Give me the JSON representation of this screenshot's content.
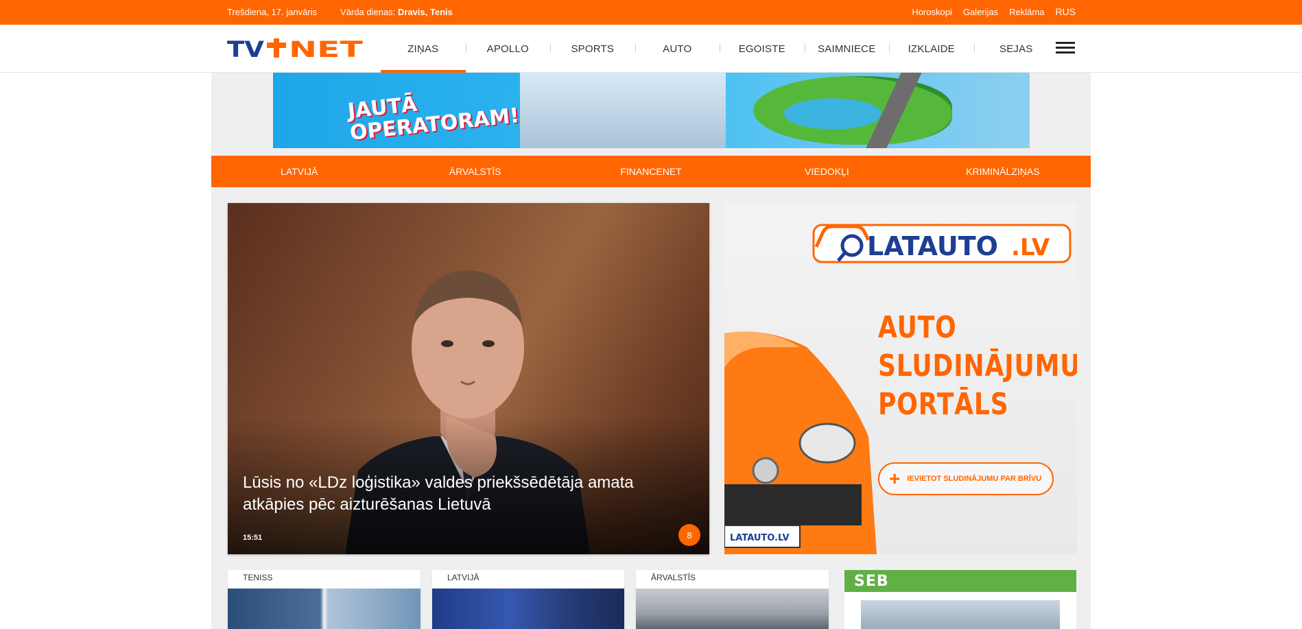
{
  "topbar": {
    "date": "Trešdiena, 17. janvāris",
    "nameday_label": "Vārda dienas:",
    "nameday_names": "Dravis, Tenis",
    "links": [
      "Horoskopi",
      "Galerijas",
      "Reklāma"
    ],
    "lang": "RUS"
  },
  "header": {
    "logo_text": "TV+NET",
    "nav": [
      "ZIŅAS",
      "APOLLO",
      "SPORTS",
      "AUTO",
      "EGOISTE",
      "SAIMNIECE",
      "IZKLAIDE",
      "SEJAS"
    ],
    "active_nav": "ZIŅAS"
  },
  "banner": {
    "line1": "JAUTĀ",
    "line2": "OPERATORAM!"
  },
  "subnav": [
    "LATVIJĀ",
    "ĀRVALSTĪS",
    "FINANCENET",
    "VIEDOKĻI",
    "KRIMINĀLZIŅAS"
  ],
  "hero": {
    "title": "Lūsis no «LDz loģistika» valdes priekšsēdētāja amata atkāpies pēc aizturēšanas Lietuvā",
    "time": "15:51",
    "comments": "8"
  },
  "side_ad": {
    "logo_main": "LATAUTO",
    "logo_tld": ".LV",
    "headline_1": "AUTO",
    "headline_2": "SLUDINĀJUMU",
    "headline_3": "PORTĀLS",
    "cta": "IEVIETOT SLUDINĀJUMU PAR BRĪVU",
    "plate": "LATAUTO.LV"
  },
  "cards": [
    {
      "category": "TENISS"
    },
    {
      "category": "LATVIJĀ"
    },
    {
      "category": "ĀRVALSTĪS"
    }
  ],
  "seb": {
    "label": "SEB"
  },
  "colors": {
    "brand_orange": "#ff6500",
    "seb_green": "#60b045",
    "logo_blue": "#1d3e93"
  }
}
